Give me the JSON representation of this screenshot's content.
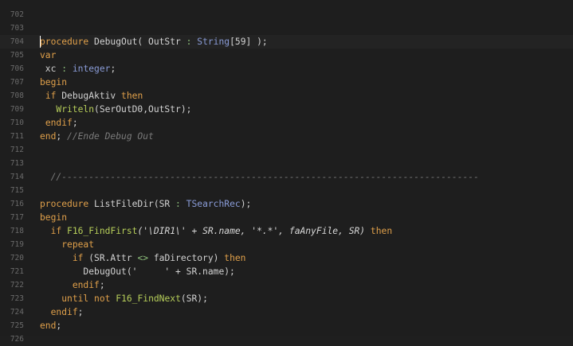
{
  "editor": {
    "lines": [
      {
        "n": "702",
        "tokens": []
      },
      {
        "n": "703",
        "tokens": []
      },
      {
        "n": "704",
        "current": true,
        "tokens": [
          {
            "t": "procedure",
            "c": "kw"
          },
          {
            "t": " DebugOut( OutStr ",
            "c": ""
          },
          {
            "t": ":",
            "c": "op"
          },
          {
            "t": " ",
            "c": ""
          },
          {
            "t": "String",
            "c": "type"
          },
          {
            "t": "[59] );",
            "c": ""
          }
        ]
      },
      {
        "n": "705",
        "tokens": [
          {
            "t": "var",
            "c": "kw"
          }
        ]
      },
      {
        "n": "706",
        "tokens": [
          {
            "t": " xc ",
            "c": ""
          },
          {
            "t": ":",
            "c": "op"
          },
          {
            "t": " ",
            "c": ""
          },
          {
            "t": "integer",
            "c": "type"
          },
          {
            "t": ";",
            "c": ""
          }
        ]
      },
      {
        "n": "707",
        "tokens": [
          {
            "t": "begin",
            "c": "kw"
          }
        ]
      },
      {
        "n": "708",
        "tokens": [
          {
            "t": " ",
            "c": ""
          },
          {
            "t": "if",
            "c": "kw"
          },
          {
            "t": " DebugAktiv ",
            "c": ""
          },
          {
            "t": "then",
            "c": "kw"
          }
        ]
      },
      {
        "n": "709",
        "tokens": [
          {
            "t": "   ",
            "c": ""
          },
          {
            "t": "Writeln",
            "c": "fn"
          },
          {
            "t": "(SerOutD0,OutStr);",
            "c": ""
          }
        ]
      },
      {
        "n": "710",
        "tokens": [
          {
            "t": " ",
            "c": ""
          },
          {
            "t": "endif",
            "c": "kw"
          },
          {
            "t": ";",
            "c": ""
          }
        ]
      },
      {
        "n": "711",
        "tokens": [
          {
            "t": "end",
            "c": "kw"
          },
          {
            "t": "; ",
            "c": ""
          },
          {
            "t": "//Ende Debug Out",
            "c": "cm"
          }
        ]
      },
      {
        "n": "712",
        "tokens": []
      },
      {
        "n": "713",
        "tokens": []
      },
      {
        "n": "714",
        "tokens": [
          {
            "t": "  //-----------------------------------------------------------------------------",
            "c": "cm"
          }
        ]
      },
      {
        "n": "715",
        "tokens": []
      },
      {
        "n": "716",
        "tokens": [
          {
            "t": "procedure",
            "c": "kw"
          },
          {
            "t": " ListFileDir(SR ",
            "c": ""
          },
          {
            "t": ":",
            "c": "op"
          },
          {
            "t": " ",
            "c": ""
          },
          {
            "t": "TSearchRec",
            "c": "type"
          },
          {
            "t": ");",
            "c": ""
          }
        ]
      },
      {
        "n": "717",
        "tokens": [
          {
            "t": "begin",
            "c": "kw"
          }
        ]
      },
      {
        "n": "718",
        "tokens": [
          {
            "t": "  ",
            "c": ""
          },
          {
            "t": "if",
            "c": "kw"
          },
          {
            "t": " ",
            "c": ""
          },
          {
            "t": "F16_FindFirst",
            "c": "fn"
          },
          {
            "t": "('\\DIR1\\' + SR.name, '*.*', faAnyFile, SR) ",
            "c": "it"
          },
          {
            "t": "then",
            "c": "kw"
          }
        ]
      },
      {
        "n": "719",
        "tokens": [
          {
            "t": "    ",
            "c": ""
          },
          {
            "t": "repeat",
            "c": "kw"
          }
        ]
      },
      {
        "n": "720",
        "tokens": [
          {
            "t": "      ",
            "c": ""
          },
          {
            "t": "if",
            "c": "kw"
          },
          {
            "t": " (SR.Attr ",
            "c": ""
          },
          {
            "t": "<>",
            "c": "op"
          },
          {
            "t": " faDirectory) ",
            "c": ""
          },
          {
            "t": "then",
            "c": "kw"
          }
        ]
      },
      {
        "n": "721",
        "tokens": [
          {
            "t": "        DebugOut(",
            "c": ""
          },
          {
            "t": "'     '",
            "c": "str"
          },
          {
            "t": " + SR.name);",
            "c": ""
          }
        ]
      },
      {
        "n": "722",
        "tokens": [
          {
            "t": "      ",
            "c": ""
          },
          {
            "t": "endif",
            "c": "kw"
          },
          {
            "t": ";",
            "c": ""
          }
        ]
      },
      {
        "n": "723",
        "tokens": [
          {
            "t": "    ",
            "c": ""
          },
          {
            "t": "until",
            "c": "kw"
          },
          {
            "t": " ",
            "c": ""
          },
          {
            "t": "not",
            "c": "kw"
          },
          {
            "t": " ",
            "c": ""
          },
          {
            "t": "F16_FindNext",
            "c": "fn"
          },
          {
            "t": "(SR);",
            "c": ""
          }
        ]
      },
      {
        "n": "724",
        "tokens": [
          {
            "t": "  ",
            "c": ""
          },
          {
            "t": "endif",
            "c": "kw"
          },
          {
            "t": ";",
            "c": ""
          }
        ]
      },
      {
        "n": "725",
        "tokens": [
          {
            "t": "end",
            "c": "kw"
          },
          {
            "t": ";",
            "c": ""
          }
        ]
      },
      {
        "n": "726",
        "tokens": []
      }
    ]
  },
  "colors": {
    "background": "#1e1e1e",
    "keyword": "#e0a04a",
    "type": "#8a9cd8",
    "function": "#b7cf5a",
    "comment": "#7b7b7b",
    "text": "#d2d2d2"
  }
}
